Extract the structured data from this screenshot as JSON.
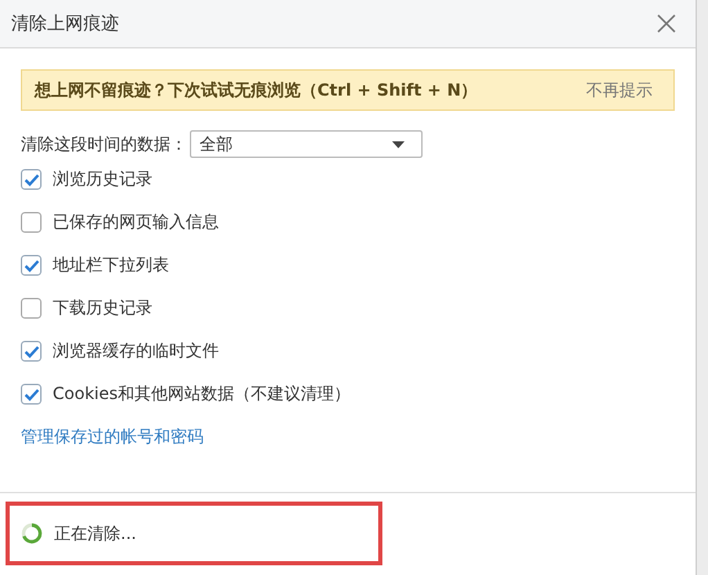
{
  "window": {
    "title": "清除上网痕迹"
  },
  "banner": {
    "message": "想上网不留痕迹？下次试试无痕浏览（Ctrl + Shift + N）",
    "dismiss": "不再提示"
  },
  "time_range": {
    "label": "清除这段时间的数据：",
    "value": "全部"
  },
  "options": [
    {
      "label": "浏览历史记录",
      "checked": true
    },
    {
      "label": "已保存的网页输入信息",
      "checked": false
    },
    {
      "label": "地址栏下拉列表",
      "checked": true
    },
    {
      "label": "下载历史记录",
      "checked": false
    },
    {
      "label": "浏览器缓存的临时文件",
      "checked": true
    },
    {
      "label": "Cookies和其他网站数据（不建议清理）",
      "checked": true
    }
  ],
  "manage_link": "管理保存过的帐号和密码",
  "status": {
    "text": "正在清除...",
    "busy": true,
    "highlighted": true
  }
}
